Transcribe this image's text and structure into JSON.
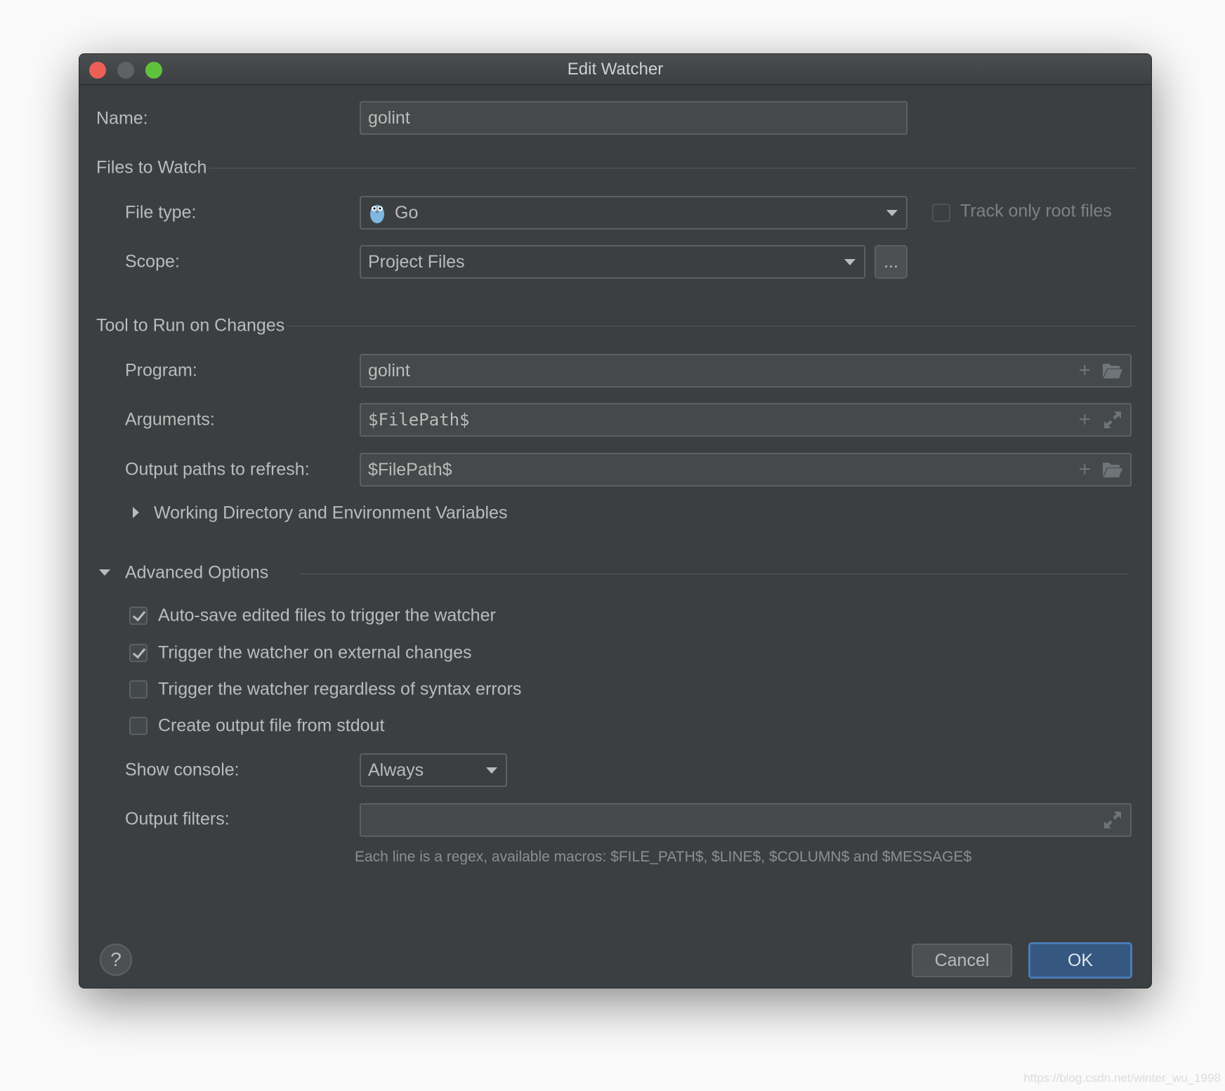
{
  "window": {
    "title": "Edit Watcher"
  },
  "name": {
    "label": "Name:",
    "value": "golint"
  },
  "files_to_watch": {
    "section": "Files to Watch",
    "file_type": {
      "label": "File type:",
      "value": "Go",
      "icon": "go-gopher-icon"
    },
    "track_root": {
      "label": "Track only root files",
      "checked": false
    },
    "scope": {
      "label": "Scope:",
      "value": "Project Files",
      "more_label": "..."
    }
  },
  "tool": {
    "section": "Tool to Run on Changes",
    "program": {
      "label": "Program:",
      "value": "golint"
    },
    "arguments": {
      "label": "Arguments:",
      "value": "$FilePath$"
    },
    "output_paths": {
      "label": "Output paths to refresh:",
      "value": "$FilePath$"
    },
    "working_dir": {
      "label": "Working Directory and Environment Variables",
      "expanded": false
    }
  },
  "advanced": {
    "section": "Advanced Options",
    "expanded": true,
    "options": [
      {
        "label": "Auto-save edited files to trigger the watcher",
        "checked": true
      },
      {
        "label": "Trigger the watcher on external changes",
        "checked": true
      },
      {
        "label": "Trigger the watcher regardless of syntax errors",
        "checked": false
      },
      {
        "label": "Create output file from stdout",
        "checked": false
      }
    ],
    "show_console": {
      "label": "Show console:",
      "value": "Always"
    },
    "output_filters": {
      "label": "Output filters:",
      "value": "",
      "hint": "Each line is a regex, available macros: $FILE_PATH$, $LINE$, $COLUMN$ and $MESSAGE$"
    }
  },
  "footer": {
    "help": "?",
    "cancel": "Cancel",
    "ok": "OK"
  },
  "watermark": "https://blog.csdn.net/winter_wu_1998",
  "colors": {
    "accent": "#365880",
    "background": "#3c3f41",
    "close": "#ec5f57",
    "minimize": "#5f6163",
    "zoom": "#5fc23d"
  }
}
